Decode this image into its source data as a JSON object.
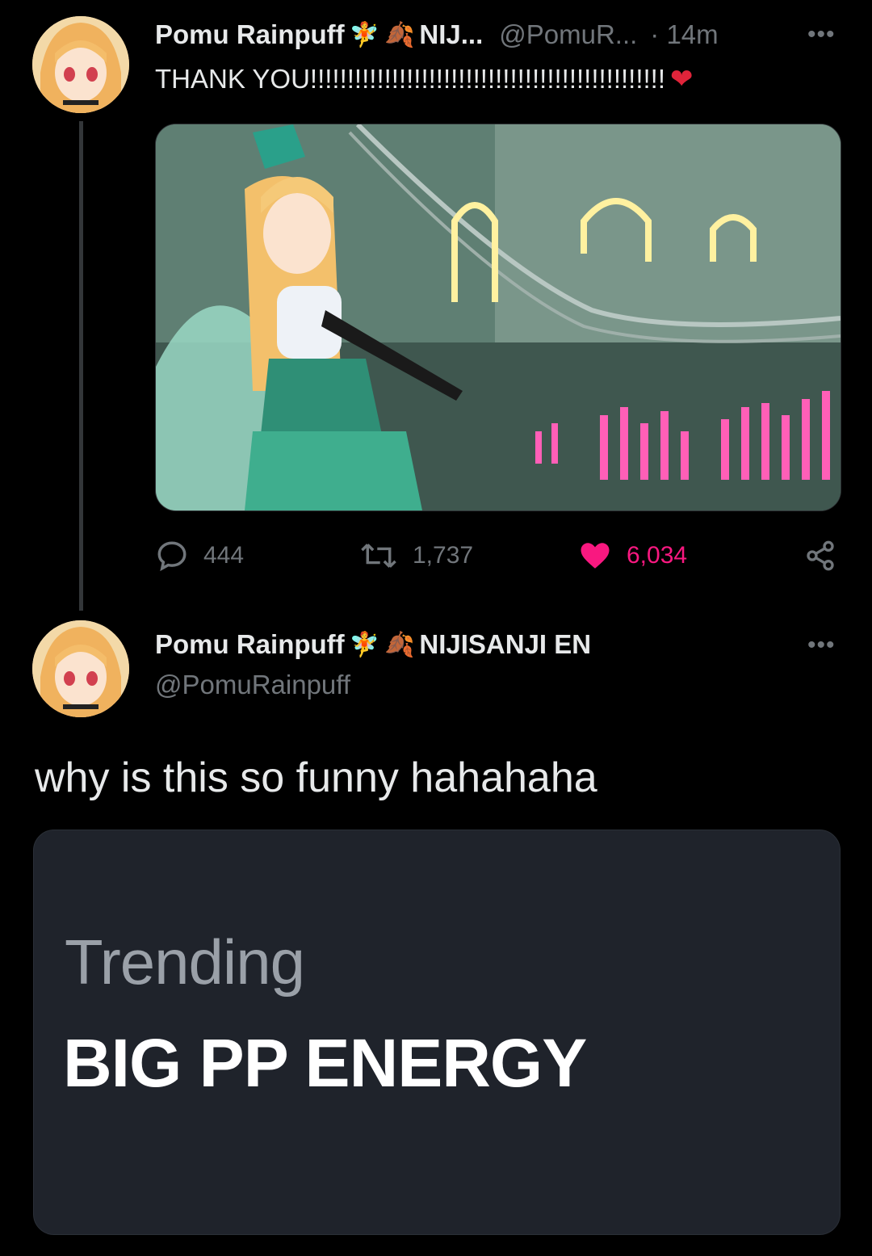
{
  "tweet1": {
    "display_name": "Pomu Rainpuff",
    "name_suffix": "NIJ...",
    "handle": "@PomuR...",
    "time": "· 14m",
    "text": "THANK YOU!!!!!!!!!!!!!!!!!!!!!!!!!!!!!!!!!!!!!!!!!!!!!!!!",
    "icons": [
      "fairy-emoji",
      "leaves-emoji",
      "heart-emoji"
    ],
    "stats": {
      "replies": "444",
      "reposts": "1,737",
      "likes": "6,034"
    }
  },
  "tweet2": {
    "display_name": "Pomu Rainpuff",
    "name_suffix": "NIJISANJI EN",
    "handle": "@PomuRainpuff",
    "text": "why is this so funny hahahaha",
    "trend": {
      "label": "Trending",
      "title": "BIG PP ENERGY"
    }
  },
  "colors": {
    "background": "#000000",
    "text": "#e7e9ea",
    "muted": "#71767b",
    "like": "#f91880",
    "card": "#1f232b"
  }
}
